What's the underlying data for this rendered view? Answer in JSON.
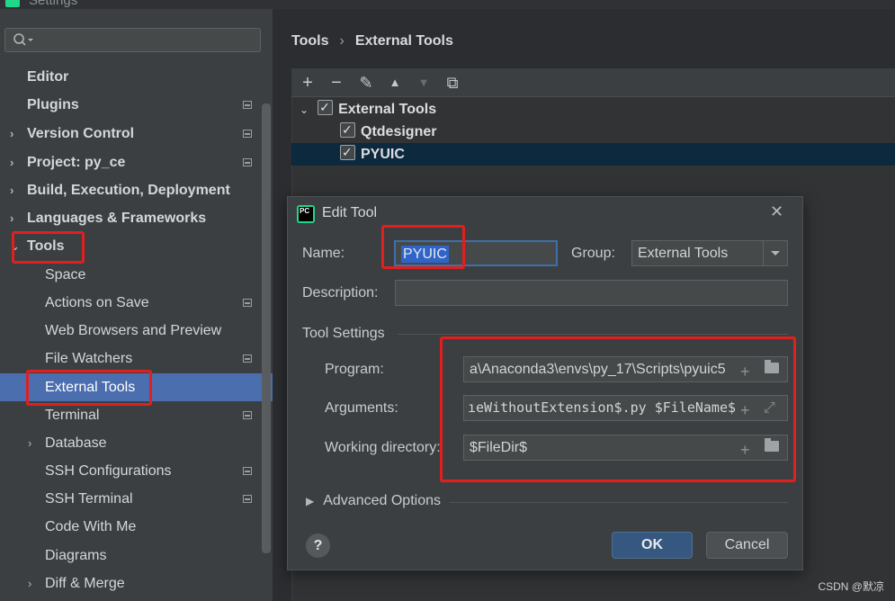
{
  "window": {
    "title": "Settings"
  },
  "sidebar": {
    "search_placeholder": "",
    "items": [
      {
        "label": "Editor",
        "bold": true,
        "chevron": "",
        "gear": false
      },
      {
        "label": "Plugins",
        "bold": true,
        "chevron": "",
        "gear": true
      },
      {
        "label": "Version Control",
        "bold": true,
        "chevron": "›",
        "gear": true
      },
      {
        "label": "Project: py_ce",
        "bold": true,
        "chevron": "›",
        "gear": true
      },
      {
        "label": "Build, Execution, Deployment",
        "bold": true,
        "chevron": "›",
        "gear": false
      },
      {
        "label": "Languages & Frameworks",
        "bold": true,
        "chevron": "›",
        "gear": false
      },
      {
        "label": "Tools",
        "bold": true,
        "chevron": "⌄",
        "gear": false
      },
      {
        "label": "Space",
        "bold": false,
        "chevron": "",
        "gear": false
      },
      {
        "label": "Actions on Save",
        "bold": false,
        "chevron": "",
        "gear": true
      },
      {
        "label": "Web Browsers and Preview",
        "bold": false,
        "chevron": "",
        "gear": false
      },
      {
        "label": "File Watchers",
        "bold": false,
        "chevron": "",
        "gear": true
      },
      {
        "label": "External Tools",
        "bold": false,
        "chevron": "",
        "gear": false,
        "selected": true
      },
      {
        "label": "Terminal",
        "bold": false,
        "chevron": "",
        "gear": true
      },
      {
        "label": "Database",
        "bold": false,
        "chevron": "›",
        "gear": false
      },
      {
        "label": "SSH Configurations",
        "bold": false,
        "chevron": "",
        "gear": true
      },
      {
        "label": "SSH Terminal",
        "bold": false,
        "chevron": "",
        "gear": true
      },
      {
        "label": "Code With Me",
        "bold": false,
        "chevron": "",
        "gear": false
      },
      {
        "label": "Diagrams",
        "bold": false,
        "chevron": "",
        "gear": false
      },
      {
        "label": "Diff & Merge",
        "bold": false,
        "chevron": "›",
        "gear": false
      }
    ]
  },
  "breadcrumb": {
    "parent": "Tools",
    "separator": "›",
    "current": "External Tools"
  },
  "toolbar": {
    "add": "+",
    "remove": "−",
    "edit": "✎",
    "up": "▲",
    "down": "▼",
    "copy": "⧉"
  },
  "tree": {
    "group": {
      "label": "External Tools",
      "checked": true
    },
    "children": [
      {
        "label": "Qtdesigner",
        "checked": true
      },
      {
        "label": "PYUIC",
        "checked": true,
        "selected": true
      }
    ]
  },
  "dialog": {
    "title": "Edit Tool",
    "name_label": "Name:",
    "name_value": "PYUIC",
    "group_label": "Group:",
    "group_value": "External Tools",
    "description_label": "Description:",
    "description_value": "",
    "tool_settings_label": "Tool Settings",
    "program_label": "Program:",
    "program_value": "a\\Anaconda3\\envs\\py_17\\Scripts\\pyuic5",
    "arguments_label": "Arguments:",
    "arguments_value": "ıeWithoutExtension$.py $FileName$",
    "workdir_label": "Working directory:",
    "workdir_value": "$FileDir$",
    "advanced_label": "Advanced Options",
    "help_label": "?",
    "ok_label": "OK",
    "cancel_label": "Cancel",
    "close_glyph": "✕",
    "icon_text": "PC"
  },
  "watermark": "CSDN @默凉",
  "colors": {
    "selection": "#4b6eaf",
    "highlight": "#e21f1f",
    "ok_button": "#365880"
  }
}
